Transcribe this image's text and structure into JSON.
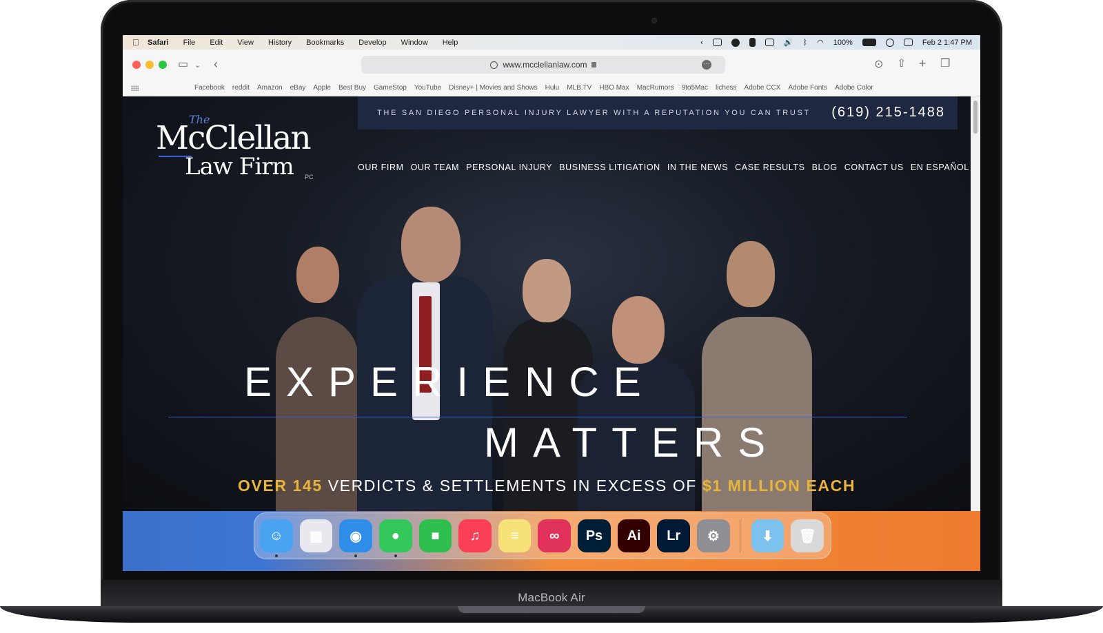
{
  "device": {
    "label": "MacBook Air"
  },
  "menubar": {
    "app": "Safari",
    "items": [
      "File",
      "Edit",
      "View",
      "History",
      "Bookmarks",
      "Develop",
      "Window",
      "Help"
    ],
    "battery": "100%",
    "datetime": "Feb 2  1:47 PM"
  },
  "toolbar": {
    "url": "www.mcclellanlaw.com"
  },
  "favorites": [
    "Facebook",
    "reddit",
    "Amazon",
    "eBay",
    "Apple",
    "Best Buy",
    "GameStop",
    "YouTube",
    "Disney+ | Movies and Shows",
    "Hulu",
    "MLB.TV",
    "HBO Max",
    "MacRumors",
    "9to5Mac",
    "lichess",
    "Adobe CCX",
    "Adobe Fonts",
    "Adobe Color"
  ],
  "site": {
    "logo": {
      "the": "The",
      "line1": "McClellan",
      "line2": "Law Firm",
      "suffix": "PC"
    },
    "tagline": "THE SAN DIEGO PERSONAL INJURY LAWYER WITH A REPUTATION YOU CAN TRUST",
    "phone": "(619) 215-1488",
    "nav": [
      "OUR FIRM",
      "OUR TEAM",
      "PERSONAL INJURY",
      "BUSINESS LITIGATION",
      "IN THE NEWS",
      "CASE RESULTS",
      "BLOG",
      "CONTACT US",
      "EN ESPAÑOL"
    ],
    "hero_line1": "EXPERIENCE",
    "hero_line2": "MATTERS",
    "sub_gold1": "OVER 145",
    "sub_middle": " VERDICTS & SETTLEMENTS IN EXCESS OF ",
    "sub_gold2": "$1 MILLION EACH"
  },
  "dock": {
    "apps": [
      {
        "name": "finder-icon",
        "glyph": "☺",
        "color": "#4aa3f0",
        "running": true
      },
      {
        "name": "launchpad-icon",
        "glyph": "▦",
        "color": "#e8e8ee",
        "running": false
      },
      {
        "name": "safari-icon",
        "glyph": "◉",
        "color": "#2f8fe8",
        "running": true
      },
      {
        "name": "messages-icon",
        "glyph": "●",
        "color": "#34c759",
        "running": true
      },
      {
        "name": "facetime-icon",
        "glyph": "■",
        "color": "#2fbf4f",
        "running": false
      },
      {
        "name": "music-icon",
        "glyph": "♫",
        "color": "#fa3f57",
        "running": false
      },
      {
        "name": "notes-icon",
        "glyph": "≡",
        "color": "#f7e27a",
        "running": false
      },
      {
        "name": "creative-cloud-icon",
        "glyph": "∞",
        "color": "#e0325a",
        "running": false
      },
      {
        "name": "photoshop-icon",
        "glyph": "Ps",
        "color": "#001e36",
        "running": false
      },
      {
        "name": "illustrator-icon",
        "glyph": "Ai",
        "color": "#330000",
        "running": false
      },
      {
        "name": "lightroom-icon",
        "glyph": "Lr",
        "color": "#001a36",
        "running": false
      },
      {
        "name": "system-preferences-icon",
        "glyph": "⚙",
        "color": "#8e8e93",
        "running": false
      }
    ],
    "extras": [
      {
        "name": "downloads-folder-icon",
        "glyph": "⬇",
        "color": "#7cc2ef"
      },
      {
        "name": "trash-icon",
        "glyph": "🗑",
        "color": "#d9d9d9"
      }
    ]
  }
}
